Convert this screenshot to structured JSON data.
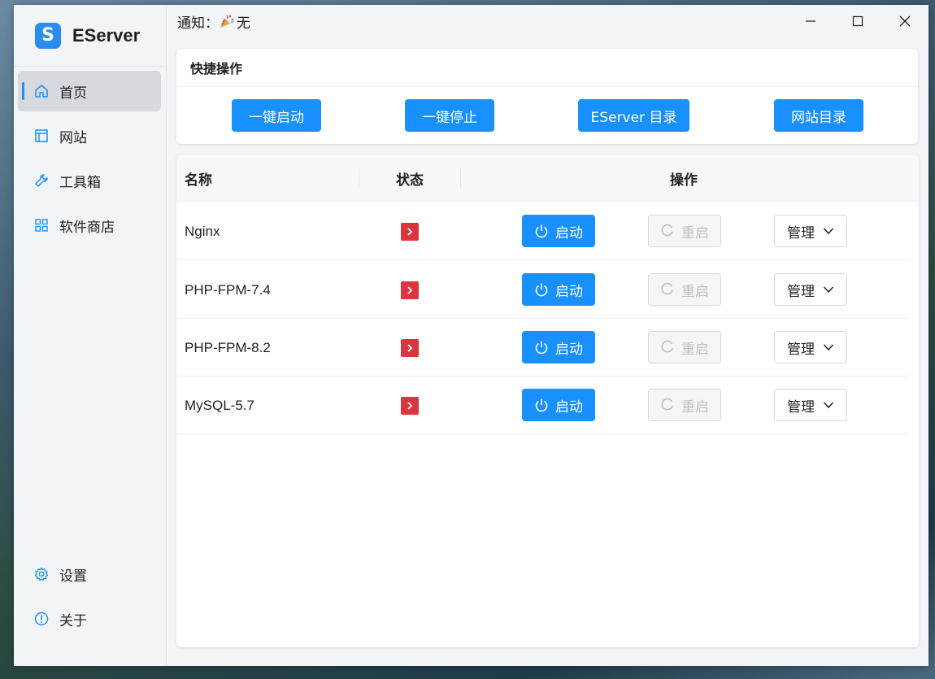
{
  "brand": {
    "logo_letter": "S",
    "name": "EServer",
    "accent": "#1890ff"
  },
  "sidebar": {
    "items": [
      {
        "label": "首页",
        "icon": "home-icon",
        "active": true
      },
      {
        "label": "网站",
        "icon": "layout-icon"
      },
      {
        "label": "工具箱",
        "icon": "wrench-icon"
      },
      {
        "label": "软件商店",
        "icon": "grid-icon"
      }
    ],
    "bottom_items": [
      {
        "label": "设置",
        "icon": "gear-icon"
      },
      {
        "label": "关于",
        "icon": "info-icon"
      }
    ]
  },
  "titlebar": {
    "notice_label": "通知：",
    "notice_value": "无",
    "notice_icon": "party-popper-icon"
  },
  "quick": {
    "title": "快捷操作",
    "buttons": [
      "一键启动",
      "一键停止",
      "EServer 目录",
      "网站目录"
    ]
  },
  "table": {
    "headers": {
      "name": "名称",
      "status": "状态",
      "actions": "操作"
    },
    "rows": [
      {
        "name": "Nginx",
        "status": "stopped",
        "start": "启动",
        "restart": "重启",
        "manage": "管理"
      },
      {
        "name": "PHP-FPM-7.4",
        "status": "stopped",
        "start": "启动",
        "restart": "重启",
        "manage": "管理"
      },
      {
        "name": "PHP-FPM-8.2",
        "status": "stopped",
        "start": "启动",
        "restart": "重启",
        "manage": "管理"
      },
      {
        "name": "MySQL-5.7",
        "status": "stopped",
        "start": "启动",
        "restart": "重启",
        "manage": "管理"
      }
    ]
  },
  "colors": {
    "primary": "#1890ff",
    "status_stopped": "#d9363e"
  }
}
